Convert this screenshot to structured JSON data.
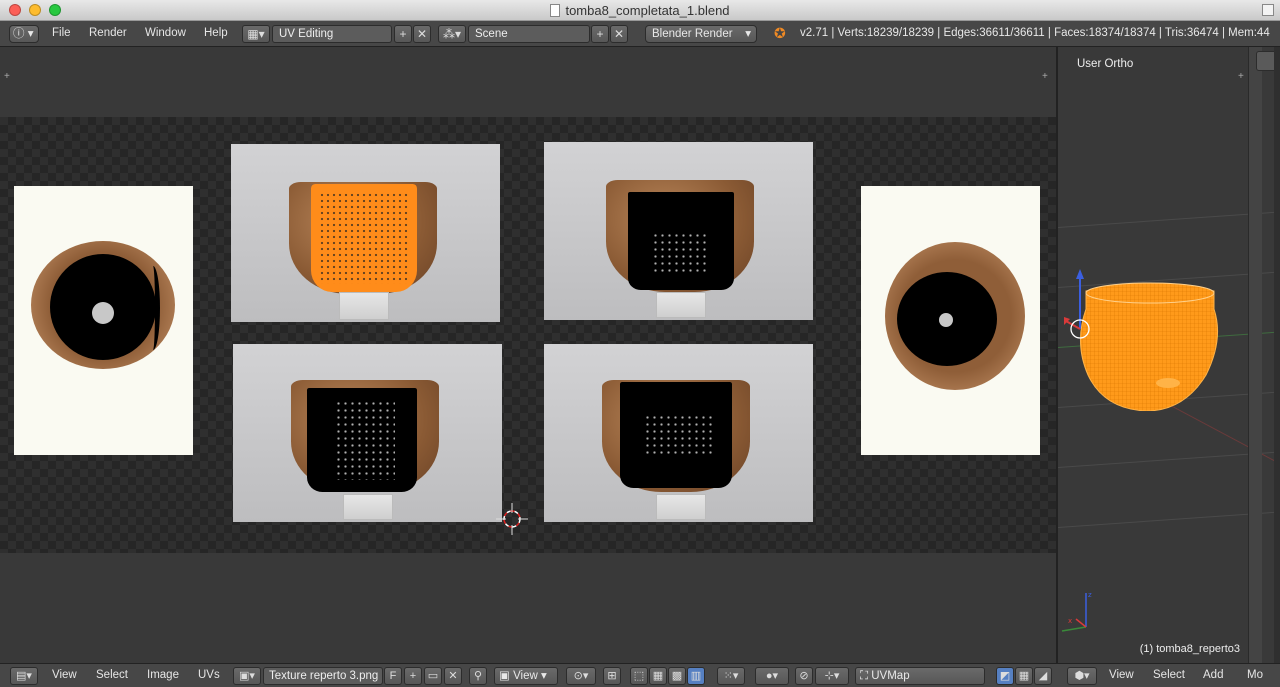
{
  "window": {
    "title": "tomba8_completata_1.blend"
  },
  "infobar": {
    "info_icon": "info-icon",
    "menus": [
      "File",
      "Render",
      "Window",
      "Help"
    ],
    "screen_layout": "UV Editing",
    "scene": "Scene",
    "render_engine": "Blender Render",
    "stats": "v2.71 | Verts:18239/18239 | Edges:36611/36611 | Faces:18374/18374 | Tris:36474 | Mem:44"
  },
  "view3d": {
    "view_label": "User Ortho",
    "object_label": "(1) tomba8_reperto3",
    "vase_color": "#ff9a1a"
  },
  "uv_editor": {
    "selected_color": "#ff8c1a",
    "uv_island_color": "#000000"
  },
  "bottombar": {
    "uv_menus": [
      "View",
      "Select",
      "Image",
      "UVs"
    ],
    "image_name": "Texture reperto 3.png",
    "image_fake_user": "F",
    "view_dropdown": "View",
    "uvmap": "UVMap",
    "v3d_menus": [
      "View",
      "Select",
      "Add",
      "Mo"
    ]
  }
}
